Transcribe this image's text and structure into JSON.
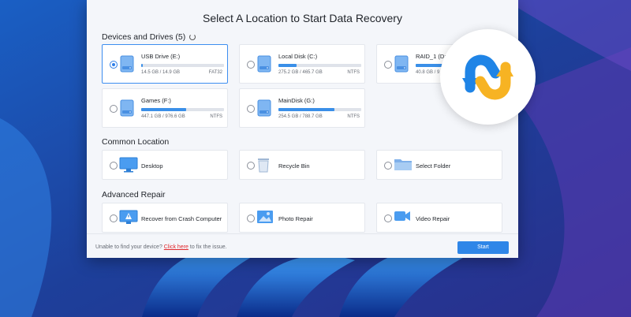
{
  "title": "Select A Location to Start Data Recovery",
  "sections": {
    "devices": "Devices and Drives (5)",
    "common": "Common Location",
    "advanced": "Advanced Repair"
  },
  "drives": [
    {
      "name": "USB Drive (E:)",
      "size": "14.5 GB / 14.9 GB",
      "fs": "FAT32",
      "usage": 0.02,
      "selected": true
    },
    {
      "name": "Local Disk (C:)",
      "size": "275.2 GB / 465.7 GB",
      "fs": "NTFS",
      "usage": 0.22
    },
    {
      "name": "RAID_1 (D:)",
      "size": "40.8 GB / 9",
      "fs": "",
      "usage": 0.5
    },
    {
      "name": "Games (F:)",
      "size": "447.1 GB / 976.6 GB",
      "fs": "NTFS",
      "usage": 0.54
    },
    {
      "name": "MainDisk (G:)",
      "size": "254.5 GB / 788.7 GB",
      "fs": "NTFS",
      "usage": 0.68
    }
  ],
  "common_locations": [
    "Desktop",
    "Recycle Bin",
    "Select Folder"
  ],
  "advanced_repair": [
    "Recover from Crash Computer",
    "Photo Repair",
    "Video Repair"
  ],
  "footer": {
    "prefix": "Unable to find your device?",
    "link": "Click here",
    "suffix": "to fix the issue.",
    "start": "Start"
  },
  "colors": {
    "accent": "#2f86e8",
    "link": "#e0262b",
    "logo_blue": "#1f84e6",
    "logo_yellow": "#f7b323"
  },
  "icons": {
    "drive": "drive-icon",
    "desktop": "monitor-icon",
    "recycle": "recycle-bin-icon",
    "folder": "folder-icon",
    "crash": "crash-computer-icon",
    "photo": "photo-icon",
    "video": "video-camera-icon",
    "logo": "recovery-app-logo"
  }
}
